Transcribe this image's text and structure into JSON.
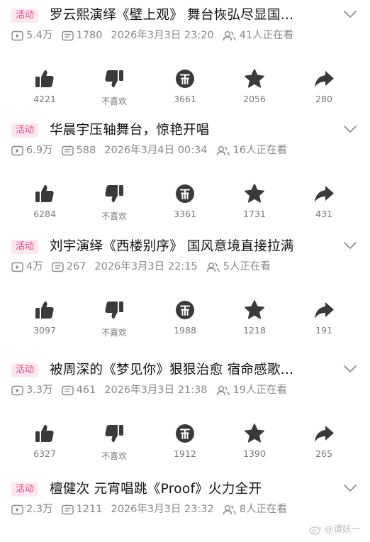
{
  "items": [
    {
      "tag": "活动",
      "title": "罗云熙演绎《壁上观》 舞台恢弘尽显国...",
      "views": "5.4万",
      "comments": "1780",
      "time": "2026年3月3日 23:20",
      "watching": "41人正在看",
      "likes": "4221",
      "dislike_label": "不喜欢",
      "coins": "3661",
      "favorites": "2056",
      "shares": "280"
    },
    {
      "tag": "活动",
      "title": "华晨宇压轴舞台，惊艳开唱",
      "views": "6.9万",
      "comments": "588",
      "time": "2026年3月4日 00:34",
      "watching": "16人正在看",
      "likes": "6284",
      "dislike_label": "不喜欢",
      "coins": "3361",
      "favorites": "1731",
      "shares": "431"
    },
    {
      "tag": "活动",
      "title": "刘宇演绎《西楼别序》 国风意境直接拉满",
      "views": "4万",
      "comments": "267",
      "time": "2026年3月3日 22:15",
      "watching": "5人正在看",
      "likes": "3097",
      "dislike_label": "不喜欢",
      "coins": "1988",
      "favorites": "1218",
      "shares": "191"
    },
    {
      "tag": "活动",
      "title": "被周深的《梦见你》狠狠治愈 宿命感歌...",
      "views": "3.3万",
      "comments": "461",
      "time": "2026年3月3日 21:38",
      "watching": "19人正在看",
      "likes": "6327",
      "dislike_label": "不喜欢",
      "coins": "1912",
      "favorites": "1390",
      "shares": "265"
    },
    {
      "tag": "活动",
      "title": "檀健次 元宵唱跳《Proof》火力全开",
      "views": "2.3万",
      "comments": "1211",
      "time": "2026年3月3日 23:32",
      "watching": "8人正在看"
    }
  ],
  "watermark": "@谭妖一",
  "colors": {
    "tag_bg": "#fde8ef",
    "tag_text": "#f0437c",
    "icon": "#3a3a3a",
    "meta": "#888888"
  },
  "icons": [
    "play-count-icon",
    "comment-count-icon",
    "viewers-icon",
    "thumbs-up-icon",
    "thumbs-down-icon",
    "coin-icon",
    "star-icon",
    "share-icon",
    "chevron-down-icon",
    "weibo-logo"
  ]
}
